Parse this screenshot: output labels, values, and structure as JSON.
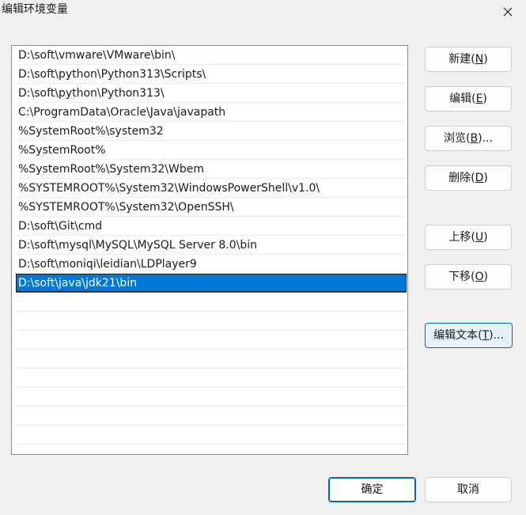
{
  "window": {
    "title": "编辑环境变量",
    "close_icon": "close-icon"
  },
  "paths": [
    "D:\\soft\\vmware\\VMware\\bin\\",
    "D:\\soft\\python\\Python313\\Scripts\\",
    "D:\\soft\\python\\Python313\\",
    "C:\\ProgramData\\Oracle\\Java\\javapath",
    "%SystemRoot%\\system32",
    "%SystemRoot%",
    "%SystemRoot%\\System32\\Wbem",
    "%SYSTEMROOT%\\System32\\WindowsPowerShell\\v1.0\\",
    "%SYSTEMROOT%\\System32\\OpenSSH\\",
    "D:\\soft\\Git\\cmd",
    "D:\\soft\\mysql\\MySQL\\MySQL Server 8.0\\bin",
    "D:\\soft\\moniqi\\leidian\\LDPlayer9",
    "D:\\soft\\java\\jdk21\\bin"
  ],
  "selected_index": 12,
  "buttons": {
    "new": {
      "pre": "新建(",
      "key": "N",
      "post": ")"
    },
    "edit": {
      "pre": "编辑(",
      "key": "E",
      "post": ")"
    },
    "browse": {
      "pre": "浏览(",
      "key": "B",
      "post": ")..."
    },
    "delete": {
      "pre": "删除(",
      "key": "D",
      "post": ")"
    },
    "move_up": {
      "pre": "上移(",
      "key": "U",
      "post": ")"
    },
    "move_down": {
      "pre": "下移(",
      "key": "O",
      "post": ")"
    },
    "edit_text": {
      "pre": "编辑文本(",
      "key": "T",
      "post": ")..."
    },
    "ok": "确定",
    "cancel": "取消"
  },
  "colors": {
    "selection": "#0078d7",
    "focus_border": "#0067c0",
    "dialog_bg": "#f0f0f0"
  }
}
